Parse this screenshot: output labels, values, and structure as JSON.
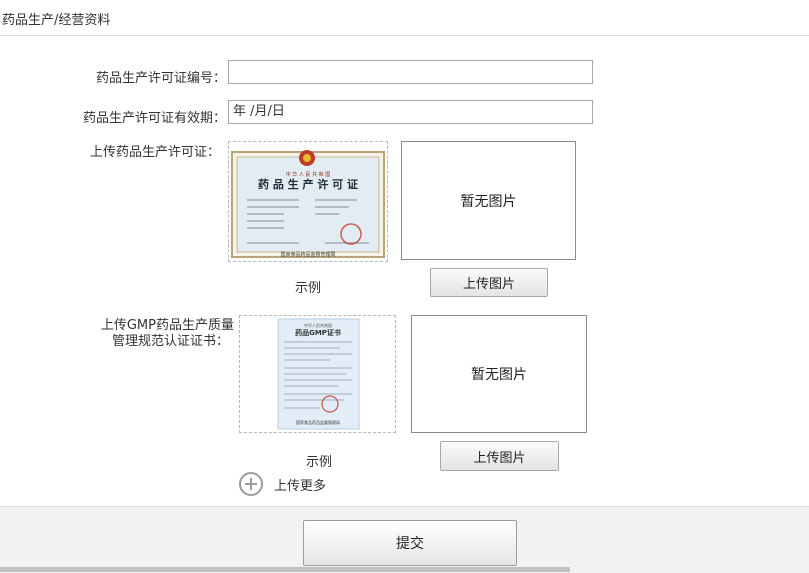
{
  "header": {
    "title": "药品生产/经营资料"
  },
  "form": {
    "license_number": {
      "label": "药品生产许可证编号：",
      "value": ""
    },
    "license_validity": {
      "label": "药品生产许可证有效期：",
      "value": "年 /月/日"
    },
    "license_upload": {
      "label": "上传药品生产许可证：",
      "sample_caption": "示例",
      "preview_text": "暂无图片",
      "upload_button": "上传图片",
      "sample_image": {
        "country": "中 华 人 民 共 和 国",
        "cert_title": "药 品 生 产 许 可 证",
        "issuer": "国家食品药品监督管理局"
      }
    },
    "gmp_upload": {
      "label_line1": "上传GMP药品生产质量",
      "label_line2": "管理规范认证证书：",
      "sample_caption": "示例",
      "preview_text": "暂无图片",
      "upload_button": "上传图片",
      "sample_image": {
        "country": "中华人民共和国",
        "cert_title": "药品GMP证书",
        "issuer": "国家食品药品监督管理局"
      }
    },
    "upload_more": "上传更多"
  },
  "footer": {
    "submit_label": "提交"
  },
  "colors": {
    "border": "#a9a9a9",
    "cert_bg": "#e6eef4",
    "seal": "#c0392b"
  }
}
